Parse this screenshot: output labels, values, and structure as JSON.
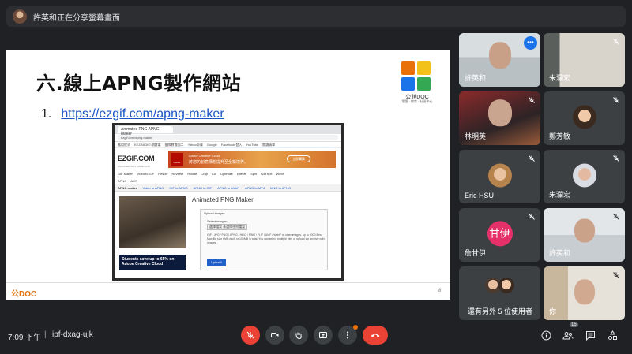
{
  "banner": {
    "text": "許英和正在分享螢幕畫面"
  },
  "slide": {
    "title": "六.線上APNG製作網站",
    "list_number": "1.",
    "link": "https://ezgif.com/apng-maker",
    "logo_label": "公館DOC",
    "logo_sub": "電腦 · 教育 · 社區中心",
    "footer": "公DOC",
    "page_number": "8",
    "logo_colors": [
      "#e8710a",
      "#f2c21b",
      "#1a73e8",
      "#34a853"
    ]
  },
  "browser": {
    "tab": "Animated PNG APNG Maker",
    "url": "ezgif.com/apng-maker",
    "bookmarks": [
      "應用程式",
      "KEZRADIO 網路電",
      "國際教會園二",
      "Yahoo奇摩",
      "Google",
      "Facebook 登入",
      "YouTube",
      "閱讀清單"
    ],
    "logo": "EZGIF.COM",
    "logo_sub": "ANIMATED GIFS MADE EASY",
    "ad_line1": "Adobe Creative Cloud",
    "ad_line2": "將您的創意構想提升至全新境界。",
    "ad_button": "立即購買",
    "ad_brand": "Adobe",
    "nav": [
      "GIF Maker",
      "Video to GIF",
      "Resize",
      "Reverse",
      "Rotate",
      "Crop",
      "Cut",
      "Optimize",
      "Effects",
      "Split",
      "Add text",
      "WebP"
    ],
    "nav2": [
      "APNG",
      "AVIF"
    ],
    "subnav": [
      "APNG maker",
      "Video to APNG",
      "GIF to APNG",
      "APNG to GIF",
      "APNG to WebP",
      "APNG to MP4",
      "MNG to APNG"
    ],
    "heading": "Animated PNG Maker",
    "upload_label": "Upload images",
    "select_label": "Select images:",
    "file_button": "選擇檔案",
    "file_text": "未選擇任何檔案",
    "info": "GIF / JPG / PNG / APNG / HEIC / MNG / FLIF / AVIF / WebP or other images, up to 2000 files. Max file size 6MB each or 100MB in total. You can select multiple files or upload zip archive with images.",
    "upload_button": "Upload!",
    "ad2": "Students save up to 65% on Adobe Creative Cloud"
  },
  "participants": [
    {
      "name": "許英和",
      "mic": "on",
      "active": true
    },
    {
      "name": "朱瀾宏",
      "mic": "muted"
    },
    {
      "name": "林明英",
      "mic": "muted"
    },
    {
      "name": "鄭芳敏",
      "mic": "muted"
    },
    {
      "name": "Eric HSU",
      "mic": "muted"
    },
    {
      "name": "朱瀾宏",
      "mic": "muted"
    },
    {
      "name": "詹甘伊",
      "mic": "muted",
      "avatar_letters": "甘伊"
    },
    {
      "name": "許英和",
      "mic": "muted"
    },
    {
      "name": "還有另外 5 位使用者"
    },
    {
      "name": "你",
      "mic": "muted"
    }
  ],
  "bottom": {
    "time": "7:09 下午",
    "separator": "|",
    "meeting_code": "ipf-dxag-ujk",
    "participant_count": "15"
  },
  "colors": {
    "background": "#202124",
    "tile": "#3c4043",
    "red": "#ea4335",
    "active_outline": "#8ab4f8",
    "more_button": "#1a73e8"
  }
}
